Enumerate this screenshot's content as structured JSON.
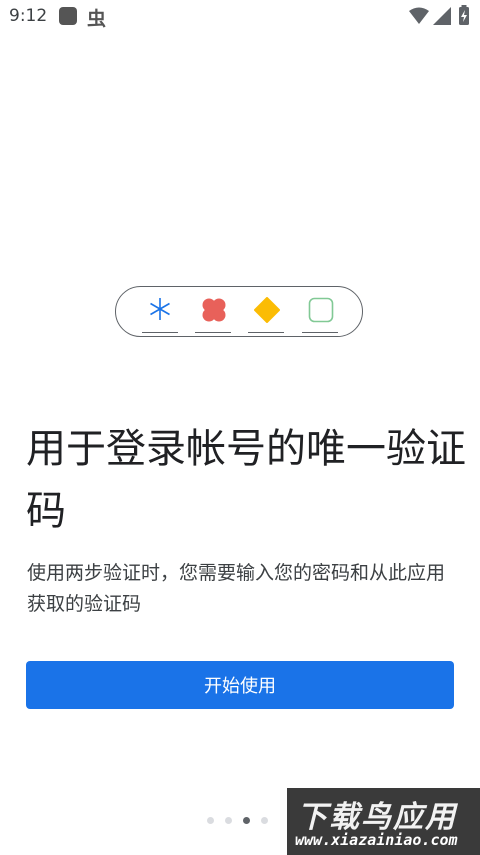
{
  "status_bar": {
    "time": "9:12",
    "icons": [
      "app-square-icon",
      "bug-icon",
      "wifi-icon",
      "signal-icon",
      "battery-charging-icon"
    ]
  },
  "illustration": {
    "slots": [
      "asterisk-icon",
      "red-flower-icon",
      "orange-diamond-icon",
      "green-square-icon"
    ],
    "colors": {
      "asterisk": "#1a73e8",
      "flower": "#e8615a",
      "diamond": "#fbbc04",
      "square": "#81c995"
    }
  },
  "main": {
    "headline": "用于登录帐号的唯一验证码",
    "description": "使用两步验证时，您需要输入您的密码和从此应用获取的验证码",
    "start_button": "开始使用"
  },
  "pager": {
    "page_count": 4,
    "current_page": 3
  },
  "watermark": {
    "top": "下载鸟应用",
    "bottom": "www.xiazainiao.com"
  }
}
